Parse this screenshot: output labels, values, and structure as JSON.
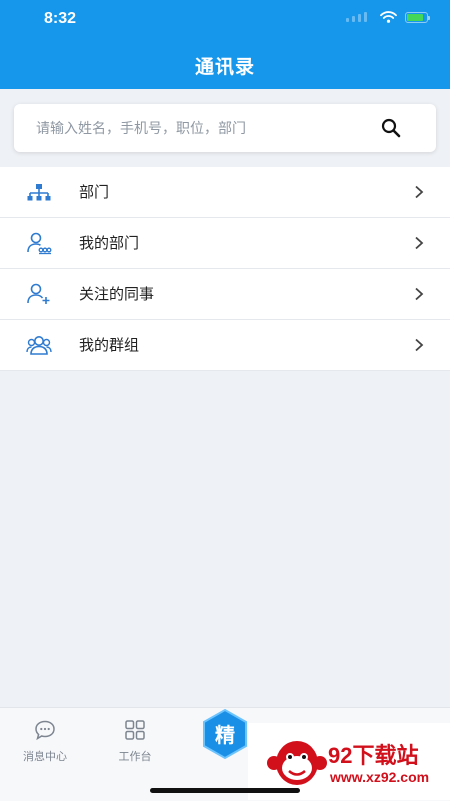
{
  "status_bar": {
    "time": "8:32"
  },
  "header": {
    "title": "通讯录"
  },
  "search": {
    "placeholder": "请输入姓名，手机号，职位，部门",
    "value": ""
  },
  "list": {
    "items": [
      {
        "label": "部门",
        "icon": "org-chart-icon"
      },
      {
        "label": "我的部门",
        "icon": "user-group-icon"
      },
      {
        "label": "关注的同事",
        "icon": "add-user-icon"
      },
      {
        "label": "我的群组",
        "icon": "users-icon"
      }
    ]
  },
  "tabbar": {
    "tabs": [
      {
        "label": "消息中心",
        "icon": "chat-icon"
      },
      {
        "label": "工作台",
        "icon": "grid-icon"
      },
      {
        "label": "精",
        "icon": "hexagon-badge-icon"
      }
    ]
  },
  "watermark": {
    "title": "92下载站",
    "url": "www.xz92.com"
  },
  "colors": {
    "primary": "#1697ec",
    "icon_blue": "#2e7bd1",
    "background": "#eef1f5",
    "watermark_red": "#d1101c"
  }
}
